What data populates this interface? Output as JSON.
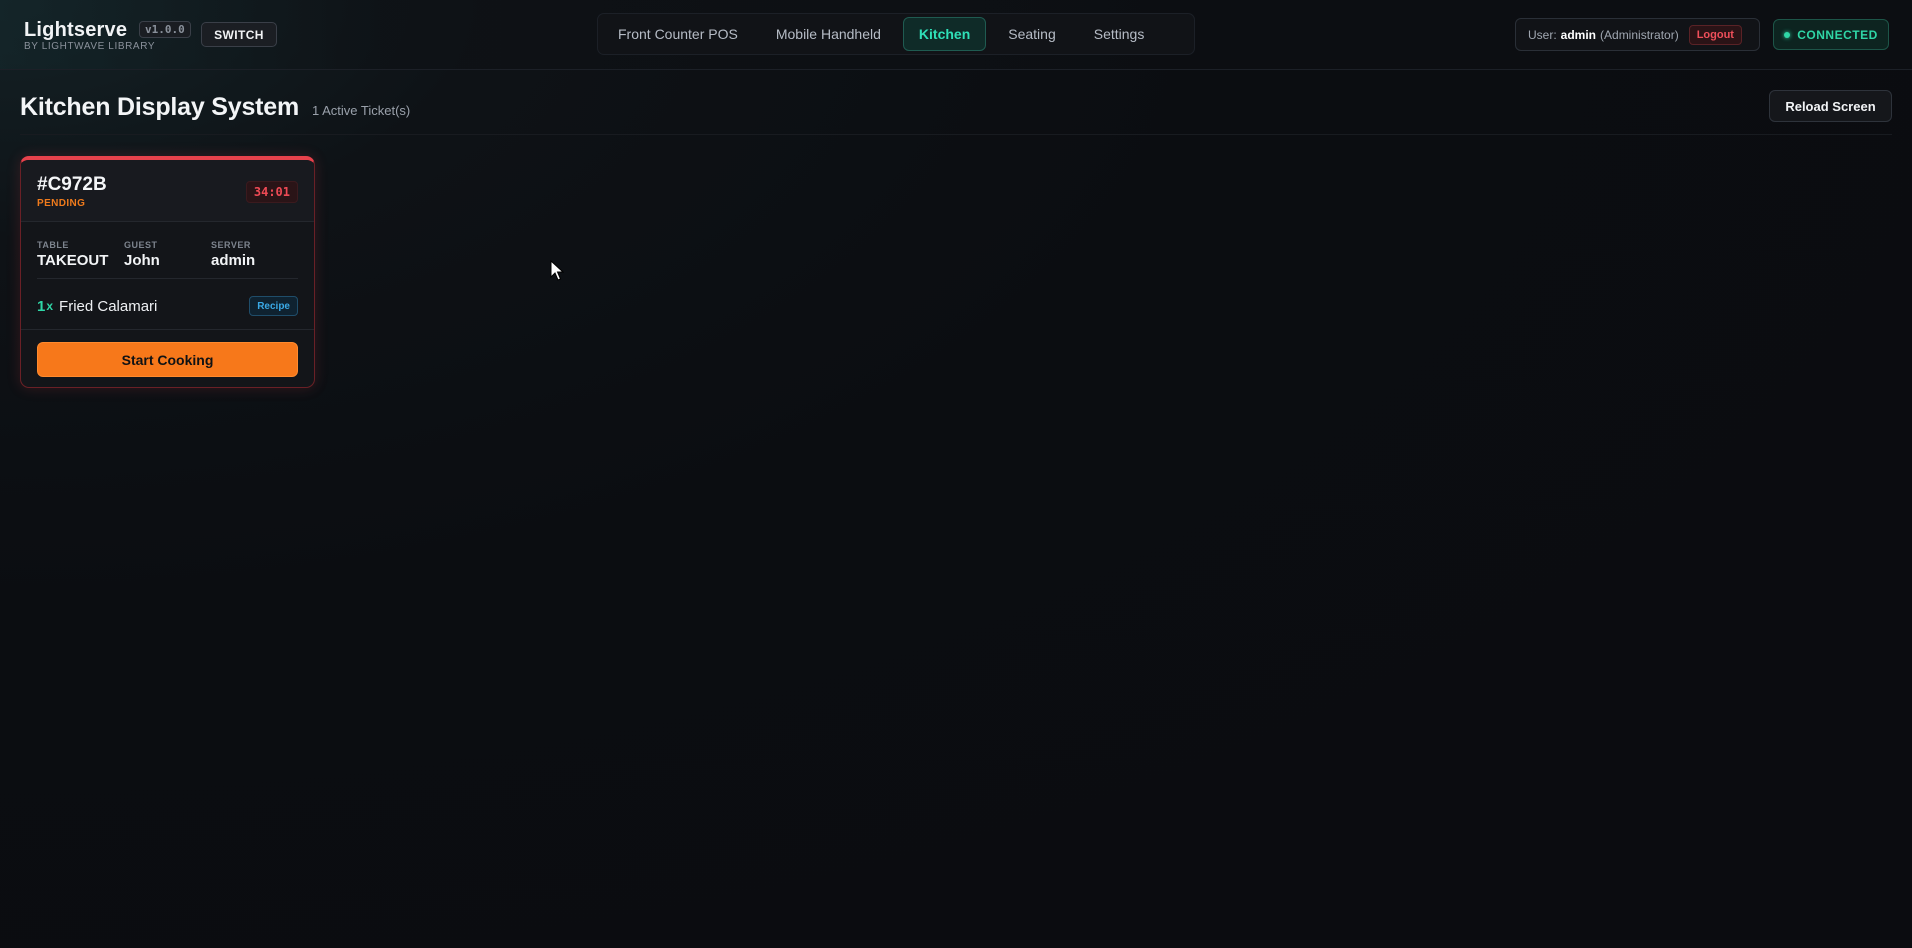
{
  "app": {
    "name": "Lightserve",
    "version": "v1.0.0",
    "subtitle": "BY LIGHTWAVE LIBRARY",
    "switch_label": "SWITCH"
  },
  "nav": {
    "tabs": [
      {
        "label": "Front Counter POS",
        "active": false
      },
      {
        "label": "Mobile Handheld",
        "active": false
      },
      {
        "label": "Kitchen",
        "active": true
      },
      {
        "label": "Seating",
        "active": false
      },
      {
        "label": "Settings",
        "active": false
      }
    ]
  },
  "user": {
    "prefix": "User:",
    "name": "admin",
    "role": "(Administrator)",
    "logout_label": "Logout"
  },
  "connection": {
    "status": "CONNECTED",
    "color": "#2fd6a6"
  },
  "page": {
    "title": "Kitchen Display System",
    "ticket_count": "1 Active Ticket(s)",
    "reload_label": "Reload Screen"
  },
  "tickets": [
    {
      "id": "#C972B",
      "status": "PENDING",
      "timer": "34:01",
      "table_label": "TABLE",
      "table": "TAKEOUT",
      "guest_label": "GUEST",
      "guest": "John",
      "server_label": "SERVER",
      "server": "admin",
      "items": [
        {
          "qty": "1",
          "qty_suffix": "x",
          "name": "Fried Calamari",
          "recipe_label": "Recipe"
        }
      ],
      "action_label": "Start Cooking",
      "accent_color": "#e8424c",
      "action_color": "#f7781a"
    }
  ]
}
